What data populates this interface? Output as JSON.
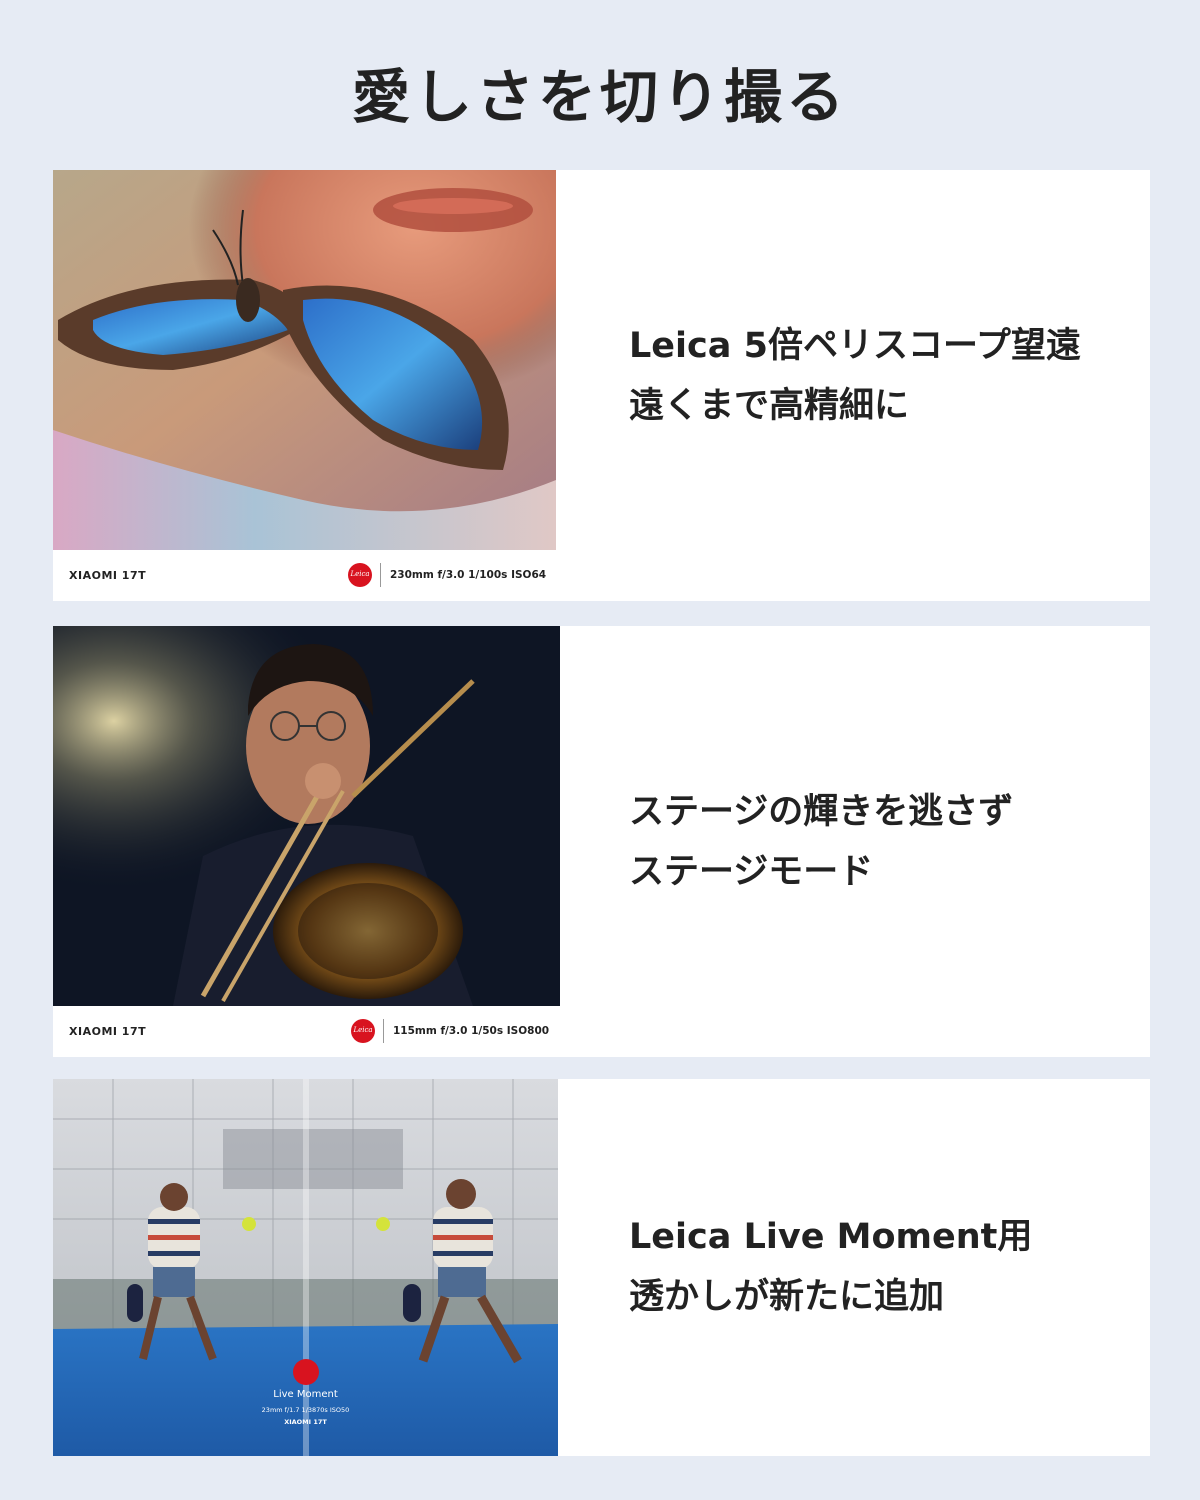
{
  "title": "愛しさを切り撮る",
  "cards": [
    {
      "headline": "Leica 5倍ペリスコープ望遠",
      "subline": "遠くまで高精細に",
      "photo": {
        "brand": "XIAOMI 17T",
        "logo": "Leica",
        "exif": "230mm  f/3.0  1/100s  ISO64"
      }
    },
    {
      "headline": "ステージの輝きを逃さず",
      "subline": "ステージモード",
      "photo": {
        "brand": "XIAOMI 17T",
        "logo": "Leica",
        "exif": "115mm  f/3.0  1/50s  ISO800"
      }
    },
    {
      "headline": "Leica Live Moment用",
      "subline": "透かしが新たに追加",
      "photo": {
        "watermark_title": "Live Moment",
        "watermark_exif": "23mm  f/1.7  1/3870s  ISO50",
        "watermark_brand": "XIAOMI 17T"
      }
    }
  ]
}
